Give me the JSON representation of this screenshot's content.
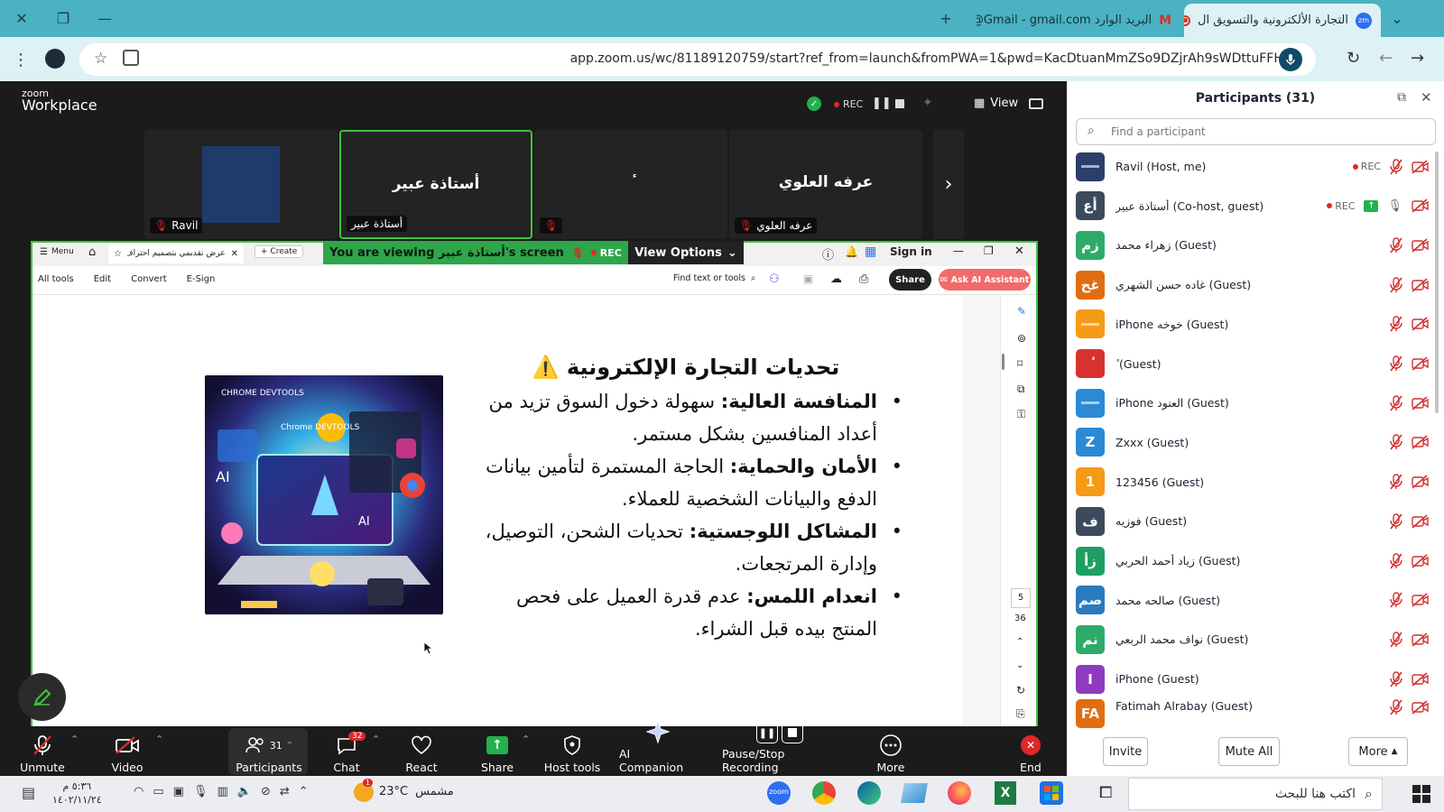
{
  "browser": {
    "tabs": [
      {
        "title": "التجارة الألكترونية والتسويق ال",
        "active": true
      },
      {
        "title": "البريد الوارد Gmail - gmail.com@",
        "active": false
      }
    ],
    "url": "app.zoom.us/wc/81189120759/start?ref_from=launch&fromPWA=1&pwd=KacDtuanMmZSo9DZjrAh9sWDttuFFH.1"
  },
  "zoom": {
    "logo_top": "zoom",
    "logo_bottom": "Workplace",
    "rec_label": "REC",
    "view_label": "View",
    "tiles": [
      {
        "name": "Ravil",
        "center": ""
      },
      {
        "name": "أستاذة عبير",
        "center": "أستاذة عبير"
      },
      {
        "name": "",
        "center": "ٔ"
      },
      {
        "name": "عرفه العلوي",
        "center": "عرفه العلوي"
      }
    ]
  },
  "share": {
    "viewing_label": "You are viewing أستاذة عبير's screen",
    "rec_label": "REC",
    "view_options": "View Options",
    "sign_in": "Sign in",
    "pdf_tab": "عرض تقديمي بتصميم احتراف...",
    "menu_label": "Menu",
    "create_label": "Create",
    "tools": [
      "All tools",
      "Edit",
      "Convert",
      "E-Sign"
    ],
    "find_label": "Find text or tools",
    "share_btn": "Share",
    "ai_btn": "Ask AI Assistant",
    "page_num": "5",
    "page_total": "36"
  },
  "slide": {
    "title": "تحديات التجارة الإلكترونية ⚠️",
    "bullets": [
      {
        "head": "المنافسة العالية:",
        "body": " سهولة دخول السوق تزيد من أعداد المنافسين بشكل مستمر."
      },
      {
        "head": "الأمان والحماية:",
        "body": " الحاجة المستمرة لتأمين بيانات الدفع والبيانات الشخصية للعملاء."
      },
      {
        "head": "المشاكل اللوجستية:",
        "body": " تحديات الشحن، التوصيل، وإدارة المرتجعات."
      },
      {
        "head": "انعدام اللمس:",
        "body": " عدم قدرة العميل على فحص المنتج بيده قبل الشراء."
      }
    ],
    "image_labels": [
      "CHROME DEVTOOLS",
      "Chrome DEVTOOLS",
      "AI",
      "AI"
    ]
  },
  "toolbar": {
    "unmute": "Unmute",
    "video": "Video",
    "participants": "Participants",
    "participants_count": "31",
    "chat": "Chat",
    "chat_badge": "32",
    "react": "React",
    "share": "Share",
    "host_tools": "Host tools",
    "ai_companion": "AI Companion",
    "recording": "Pause/Stop Recording",
    "more": "More",
    "end": "End"
  },
  "participants": {
    "title": "Participants (31)",
    "search_placeholder": "Find a participant",
    "list": [
      {
        "initials": "",
        "name": "Ravil (Host, me)",
        "color": "#2c3e6a",
        "rec": true,
        "share": false
      },
      {
        "initials": "أع",
        "name": "أستاذة عبير (Co-host, guest)",
        "color": "#3d4a5c",
        "rec": true,
        "share": true
      },
      {
        "initials": "زم",
        "name": "زهراء محمد (Guest)",
        "color": "#2eab6a",
        "rec": false,
        "share": false
      },
      {
        "initials": "غح",
        "name": "غاده حسن الشهري (Guest)",
        "color": "#e06d12",
        "rec": false,
        "share": false
      },
      {
        "initials": "",
        "name": "iPhone خوخه (Guest)",
        "color": "#f59a15",
        "rec": false,
        "share": false
      },
      {
        "initials": "ٔ",
        "name": "ٔ (Guest)",
        "color": "#d7322e",
        "rec": false,
        "share": false
      },
      {
        "initials": "",
        "name": "iPhone العنود (Guest)",
        "color": "#2a8ad6",
        "rec": false,
        "share": false
      },
      {
        "initials": "Z",
        "name": "Zxxx (Guest)",
        "color": "#2a8ad6",
        "rec": false,
        "share": false
      },
      {
        "initials": "1",
        "name": "123456 (Guest)",
        "color": "#f59a15",
        "rec": false,
        "share": false
      },
      {
        "initials": "ف",
        "name": "فوزيه (Guest)",
        "color": "#3d4a5c",
        "rec": false,
        "share": false
      },
      {
        "initials": "زأ",
        "name": "زياد أحمد الحربي (Guest)",
        "color": "#1f9e63",
        "rec": false,
        "share": false
      },
      {
        "initials": "صم",
        "name": "صالحه محمد (Guest)",
        "color": "#2a7ac0",
        "rec": false,
        "share": false
      },
      {
        "initials": "نم",
        "name": "نواف محمد الربعي (Guest)",
        "color": "#2eab6a",
        "rec": false,
        "share": false
      },
      {
        "initials": "I",
        "name": "iPhone (Guest)",
        "color": "#8e3bbf",
        "rec": false,
        "share": false
      },
      {
        "initials": "FA",
        "name": "Fatimah Alrabay (Guest)",
        "color": "#e06d12",
        "rec": false,
        "share": false
      }
    ],
    "invite": "Invite",
    "mute_all": "Mute All",
    "more": "More"
  },
  "taskbar": {
    "time": "٥:٣٦ م",
    "date": "١٤٠٢/١١/٢٤",
    "weather_temp": "23°C",
    "weather_label": "مشمس",
    "search_placeholder": "اكتب هنا للبحث",
    "notif_count": "1"
  }
}
